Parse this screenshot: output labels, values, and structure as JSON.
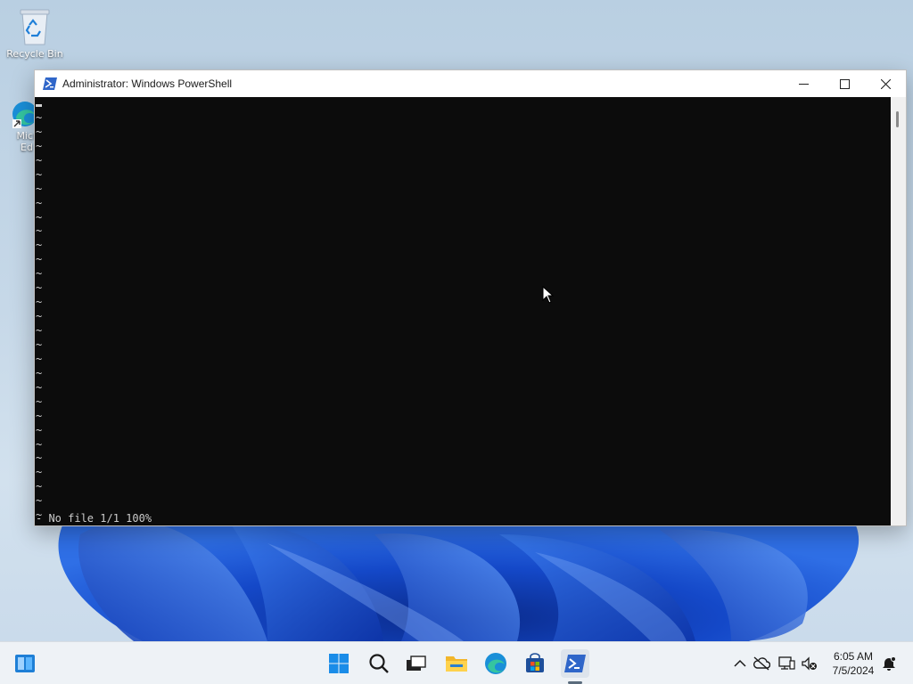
{
  "desktop": {
    "icons": [
      {
        "label": "Recycle Bin"
      },
      {
        "label": "Micr Ed"
      }
    ]
  },
  "window": {
    "title": "Administrator: Windows PowerShell",
    "console": {
      "tilde_lines": [
        "~",
        "~",
        "~",
        "~",
        "~",
        "~",
        "~",
        "~",
        "~",
        "~",
        "~",
        "~",
        "~",
        "~",
        "~",
        "~",
        "~",
        "~",
        "~",
        "~",
        "~",
        "~",
        "~",
        "~",
        "~",
        "~",
        "~",
        "~",
        "~"
      ],
      "status": "- No file 1/1 100%"
    }
  },
  "taskbar": {
    "clock_time": "6:05 AM",
    "clock_date": "7/5/2024"
  },
  "colors": {
    "accent": "#0078d4",
    "console_bg": "#0c0c0c",
    "console_fg": "#cccccc"
  }
}
